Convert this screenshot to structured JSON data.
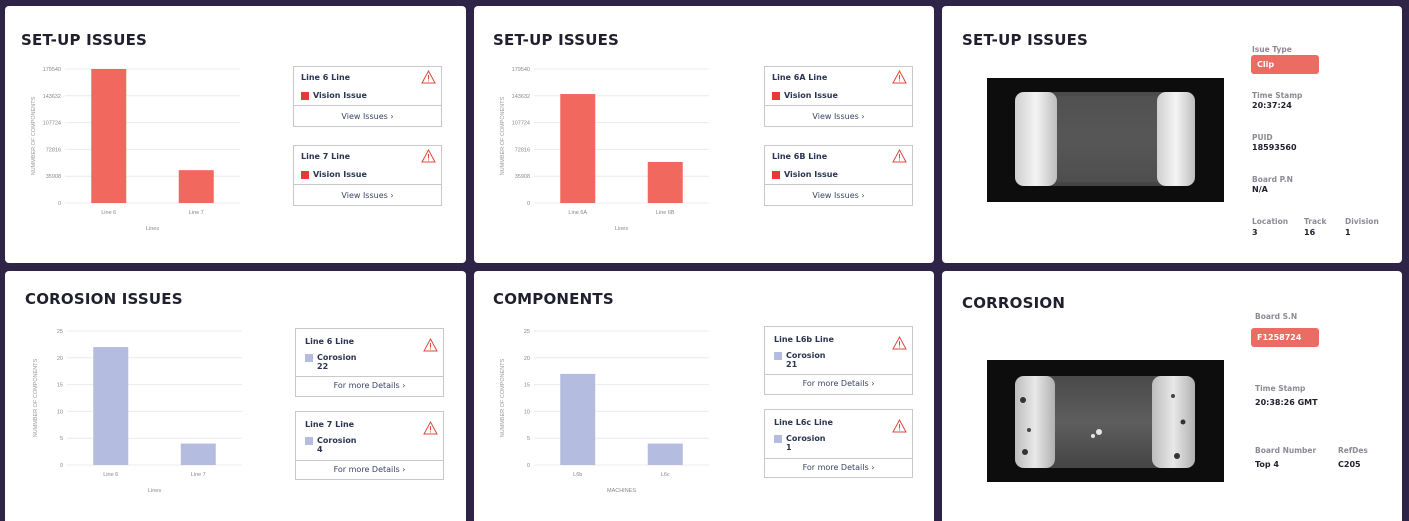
{
  "colors": {
    "red_bar": "#f1685e",
    "blue_bar": "#b4bddf",
    "pill": "#ec6b63",
    "vision_issue": "#e53935",
    "corrosion": "#b4bddf"
  },
  "panel1": {
    "title": "SET-UP ISSUES",
    "boxes": [
      {
        "line": "Line 6 Line",
        "legend": "Vision Issue",
        "link": "View Issues"
      },
      {
        "line": "Line 7 Line",
        "legend": "Vision Issue",
        "link": "View Issues"
      }
    ],
    "chart_data": {
      "type": "bar",
      "categories": [
        "Line 6",
        "Line 7"
      ],
      "values": [
        179540,
        44000
      ],
      "yticks": [
        "0",
        "35908",
        "72816",
        "107724",
        "143632",
        "179540"
      ],
      "ylim": [
        0,
        179540
      ],
      "xlabel": "Lines",
      "ylabel": "NUMMBER OF COMPONENTS"
    }
  },
  "panel2": {
    "title": "SET-UP ISSUES",
    "boxes": [
      {
        "line": "Line 6A Line",
        "legend": "Vision Issue",
        "link": "View Issues"
      },
      {
        "line": "Line 6B Line",
        "legend": "Vision Issue",
        "link": "View Issues"
      }
    ],
    "chart_data": {
      "type": "bar",
      "categories": [
        "Line 6A",
        "Line 6B"
      ],
      "values": [
        146000,
        55000
      ],
      "yticks": [
        "0",
        "35908",
        "72816",
        "107724",
        "143632",
        "179540"
      ],
      "ylim": [
        0,
        179540
      ],
      "xlabel": "Lines",
      "ylabel": "NUMMBER OF COMPONENTS"
    }
  },
  "panel3": {
    "title": "SET-UP ISSUES",
    "issue_type_label": "Isue Type",
    "issue_type": "Clip",
    "timestamp_label": "Time Stamp",
    "timestamp": "20:37:24",
    "puid_label": "PUID",
    "puid": "18593560",
    "board_pn_label": "Board P.N",
    "board_pn": "N/A",
    "location_label": "Location",
    "location": "3",
    "track_label": "Track",
    "track": "16",
    "division_label": "Division",
    "division": "1"
  },
  "panel4": {
    "title": "COROSION ISSUES",
    "boxes": [
      {
        "line": "Line 6 Line",
        "legend": "Corosion",
        "count": "22",
        "link": "For more Details"
      },
      {
        "line": "Line 7 Line",
        "legend": "Corosion",
        "count": "4",
        "link": "For more Details"
      }
    ],
    "chart_data": {
      "type": "bar",
      "categories": [
        "Line 6",
        "Line 7"
      ],
      "values": [
        22,
        4
      ],
      "yticks": [
        "0",
        "5",
        "10",
        "15",
        "20",
        "25"
      ],
      "ylim": [
        0,
        25
      ],
      "xlabel": "Lines",
      "ylabel": "NUMMBER OF COMPONENTS"
    }
  },
  "panel5": {
    "title": "COMPONENTS",
    "boxes": [
      {
        "line": "Line L6b Line",
        "legend": "Corosion",
        "count": "21",
        "link": "For more Details"
      },
      {
        "line": "Line L6c Line",
        "legend": "Corosion",
        "count": "1",
        "link": "For more Details"
      }
    ],
    "chart_data": {
      "type": "bar",
      "categories": [
        "L6b",
        "L6c"
      ],
      "values": [
        17,
        4
      ],
      "yticks": [
        "0",
        "5",
        "10",
        "15",
        "20",
        "25"
      ],
      "ylim": [
        0,
        25
      ],
      "xlabel": "MACHINES",
      "ylabel": "NUMMBER OF COMPONENTS"
    }
  },
  "panel6": {
    "title": "CORROSION",
    "board_sn_label": "Board S.N",
    "board_sn": "F1258724",
    "timestamp_label": "Time Stamp",
    "timestamp": "20:38:26 GMT",
    "board_number_label": "Board Number",
    "board_number": "Top 4",
    "refdes_label": "RefDes",
    "refdes": "C205"
  }
}
